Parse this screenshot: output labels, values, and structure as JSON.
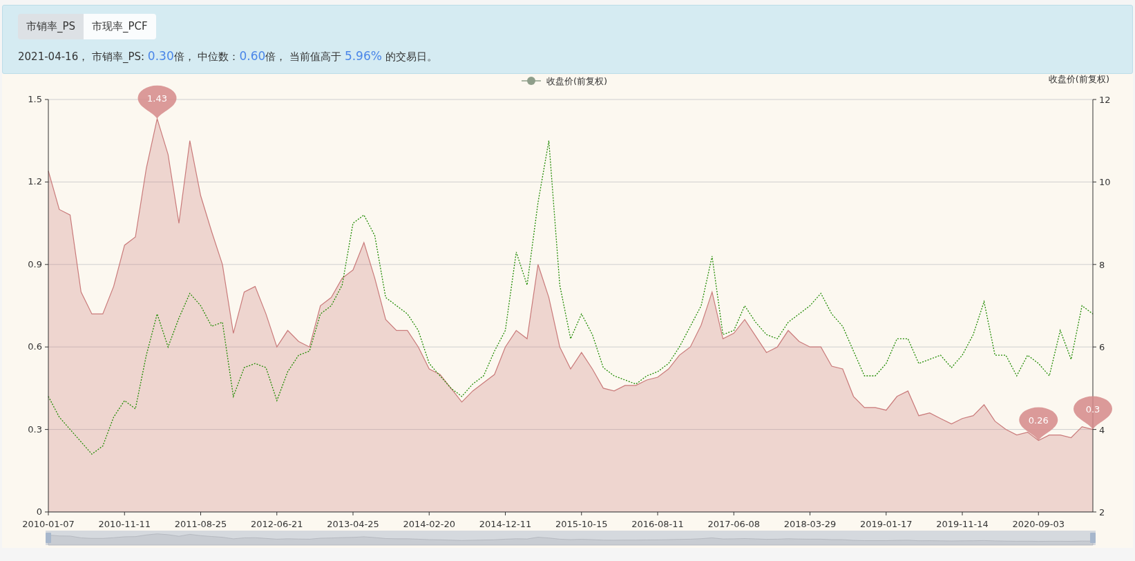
{
  "tabs": [
    {
      "label": "市销率_PS",
      "selected": true
    },
    {
      "label": "市现率_PCF",
      "selected": false
    }
  ],
  "summary": [
    {
      "text": "2021-04-16， 市销率_PS: ",
      "highlight": false
    },
    {
      "text": "0.30",
      "highlight": true
    },
    {
      "text": "倍， 中位数：",
      "highlight": false
    },
    {
      "text": "0.60",
      "highlight": true
    },
    {
      "text": "倍， 当前值高于 ",
      "highlight": false
    },
    {
      "text": "5.96%",
      "highlight": true
    },
    {
      "text": " 的交易日。",
      "highlight": false
    }
  ],
  "chart": {
    "chart_data": {
      "type": "area",
      "grid": true,
      "ylim": [
        0,
        1.5
      ],
      "yticks": [
        0,
        0.3,
        0.6,
        0.9,
        1.2,
        1.5
      ],
      "y2label": "收盘价(前复权)",
      "y2lim": [
        2,
        12
      ],
      "y2ticks": [
        2,
        4,
        6,
        8,
        10,
        12
      ],
      "categories": [
        "2010-01-07",
        null,
        null,
        null,
        null,
        null,
        null,
        "2010-11-11",
        null,
        null,
        null,
        null,
        null,
        null,
        "2011-08-25",
        null,
        null,
        null,
        null,
        null,
        null,
        "2012-06-21",
        null,
        null,
        null,
        null,
        null,
        null,
        "2013-04-25",
        null,
        null,
        null,
        null,
        null,
        null,
        "2014-02-20",
        null,
        null,
        null,
        null,
        null,
        null,
        "2014-12-11",
        null,
        null,
        null,
        null,
        null,
        null,
        "2015-10-15",
        null,
        null,
        null,
        null,
        null,
        null,
        "2016-08-11",
        null,
        null,
        null,
        null,
        null,
        null,
        "2017-06-08",
        null,
        null,
        null,
        null,
        null,
        null,
        "2018-03-29",
        null,
        null,
        null,
        null,
        null,
        null,
        "2019-01-17",
        null,
        null,
        null,
        null,
        null,
        null,
        "2019-11-14",
        null,
        null,
        null,
        null,
        null,
        null,
        "2020-09-03",
        null,
        null,
        null,
        null,
        null
      ],
      "series": [
        {
          "color": "#c97a7a",
          "values": [
            1.24,
            1.1,
            1.08,
            0.8,
            0.72,
            0.72,
            0.82,
            0.97,
            1.0,
            1.25,
            1.43,
            1.3,
            1.05,
            1.35,
            1.15,
            1.02,
            0.9,
            0.65,
            0.8,
            0.82,
            0.72,
            0.6,
            0.66,
            0.62,
            0.6,
            0.75,
            0.78,
            0.85,
            0.88,
            0.98,
            0.85,
            0.7,
            0.66,
            0.66,
            0.6,
            0.52,
            0.5,
            0.45,
            0.4,
            0.44,
            0.47,
            0.5,
            0.6,
            0.66,
            0.63,
            0.9,
            0.78,
            0.6,
            0.52,
            0.58,
            0.52,
            0.45,
            0.44,
            0.46,
            0.46,
            0.48,
            0.49,
            0.52,
            0.57,
            0.6,
            0.68,
            0.8,
            0.63,
            0.65,
            0.7,
            0.64,
            0.58,
            0.6,
            0.66,
            0.62,
            0.6,
            0.6,
            0.53,
            0.52,
            0.42,
            0.38,
            0.38,
            0.37,
            0.42,
            0.44,
            0.35,
            0.36,
            0.34,
            0.32,
            0.34,
            0.35,
            0.39,
            0.33,
            0.3,
            0.28,
            0.29,
            0.26,
            0.28,
            0.28,
            0.27,
            0.31,
            0.3
          ]
        },
        {
          "name": "收盘价(前复权)",
          "color": "#1f8a00",
          "axis": "y2",
          "type": "line",
          "line_style": "dotted",
          "values": [
            4.8,
            4.3,
            4.0,
            3.7,
            3.4,
            3.6,
            4.3,
            4.7,
            4.5,
            5.8,
            6.8,
            6.0,
            6.7,
            7.3,
            7.0,
            6.5,
            6.6,
            4.8,
            5.5,
            5.6,
            5.5,
            4.7,
            5.4,
            5.8,
            5.9,
            6.8,
            7.0,
            7.5,
            9.0,
            9.2,
            8.7,
            7.2,
            7.0,
            6.8,
            6.4,
            5.6,
            5.3,
            5.0,
            4.8,
            5.1,
            5.3,
            5.9,
            6.4,
            8.3,
            7.5,
            9.5,
            11.0,
            7.5,
            6.2,
            6.8,
            6.3,
            5.5,
            5.3,
            5.2,
            5.1,
            5.3,
            5.4,
            5.6,
            6.0,
            6.5,
            7.0,
            8.2,
            6.3,
            6.4,
            7.0,
            6.6,
            6.3,
            6.2,
            6.6,
            6.8,
            7.0,
            7.3,
            6.8,
            6.5,
            5.9,
            5.3,
            5.3,
            5.6,
            6.2,
            6.2,
            5.6,
            5.7,
            5.8,
            5.5,
            5.8,
            6.3,
            7.1,
            5.8,
            5.8,
            5.3,
            5.8,
            5.6,
            5.3,
            6.4,
            5.7,
            7.0,
            6.8
          ]
        }
      ],
      "annotations": [
        "1.43",
        "0.26",
        "0.3"
      ]
    }
  }
}
